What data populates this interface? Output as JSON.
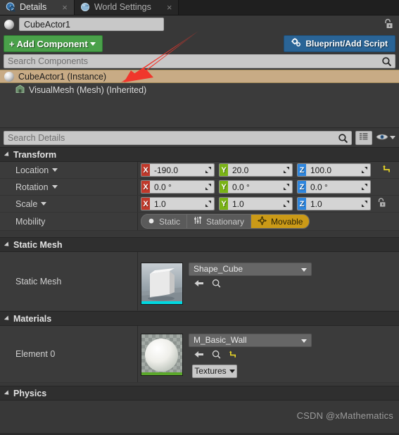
{
  "window": {
    "tabs": [
      {
        "label": "Details",
        "icon": "details-info-icon",
        "active": true,
        "close": "×"
      },
      {
        "label": "World Settings",
        "icon": "world-globe-icon",
        "active": false,
        "close": "×"
      }
    ],
    "lock_icon": "unlock-icon"
  },
  "actor": {
    "name_value": "CubeActor1",
    "icon": "actor-sphere-icon"
  },
  "toolbar": {
    "add_component_label": "Add Component",
    "add_component_plus": "+",
    "blueprint_label": "Blueprint/Add Script",
    "blueprint_icon": "blueprint-gears-icon",
    "search_components_placeholder": "Search Components",
    "search_icon": "search-icon"
  },
  "component_tree": [
    {
      "label": "CubeActor1 (Instance)",
      "icon": "actor-sphere-icon",
      "selected": true,
      "child": false
    },
    {
      "label": "VisualMesh (Mesh) (Inherited)",
      "icon": "mesh-component-icon",
      "selected": false,
      "child": true
    }
  ],
  "details_toolbar": {
    "search_details_placeholder": "Search Details",
    "search_icon": "search-icon",
    "grid_view_icon": "grid-view-icon",
    "visibility_icon": "eye-icon",
    "visibility_caret": "chevron-down-icon"
  },
  "sections": {
    "transform": {
      "title": "Transform",
      "reset_icon": "reset-arrow-icon",
      "lock_icon": "scale-lock-icon",
      "rows": [
        {
          "label": "Location",
          "has_dropdown": true,
          "fields": [
            {
              "axis": "X",
              "value": "-190.0",
              "color": "#c0392b"
            },
            {
              "axis": "Y",
              "value": "20.0",
              "color": "#7ab317"
            },
            {
              "axis": "Z",
              "value": "100.0",
              "color": "#2e86de"
            }
          ]
        },
        {
          "label": "Rotation",
          "has_dropdown": true,
          "fields": [
            {
              "axis": "X",
              "value": "0.0 °",
              "color": "#c0392b"
            },
            {
              "axis": "Y",
              "value": "0.0 °",
              "color": "#7ab317"
            },
            {
              "axis": "Z",
              "value": "0.0 °",
              "color": "#2e86de"
            }
          ]
        },
        {
          "label": "Scale",
          "has_dropdown": true,
          "fields": [
            {
              "axis": "X",
              "value": "1.0",
              "color": "#c0392b"
            },
            {
              "axis": "Y",
              "value": "1.0",
              "color": "#7ab317"
            },
            {
              "axis": "Z",
              "value": "1.0",
              "color": "#2e86de"
            }
          ]
        }
      ],
      "mobility": {
        "label": "Mobility",
        "options": [
          {
            "label": "Static",
            "icon": "static-dot-icon",
            "active": false
          },
          {
            "label": "Stationary",
            "icon": "stationary-sliders-icon",
            "active": false
          },
          {
            "label": "Movable",
            "icon": "movable-arrows-icon",
            "active": true
          }
        ],
        "active_color": "#cb9a17"
      }
    },
    "static_mesh": {
      "title": "Static Mesh",
      "row_label": "Static Mesh",
      "asset_name": "Shape_Cube",
      "thumbnail": "cube-thumbnail",
      "thumb_bar_color": "#00d8e0",
      "browse_icon": "back-arrow-icon",
      "find_icon": "search-icon",
      "dropdown_icon": "chevron-down-icon"
    },
    "materials": {
      "title": "Materials",
      "row_label": "Element 0",
      "asset_name": "M_Basic_Wall",
      "thumbnail": "material-sphere-thumbnail",
      "thumb_bar_color": "#5aa72a",
      "browse_icon": "back-arrow-icon",
      "find_icon": "search-icon",
      "reset_icon": "reset-arrow-icon",
      "textures_label": "Textures",
      "dropdown_icon": "chevron-down-icon"
    },
    "physics": {
      "title": "Physics"
    }
  },
  "annotation": {
    "arrow_color": "#f0372c",
    "arrow_name": "red-pointer-arrow"
  },
  "watermark": {
    "text": "CSDN @xMathematics"
  }
}
